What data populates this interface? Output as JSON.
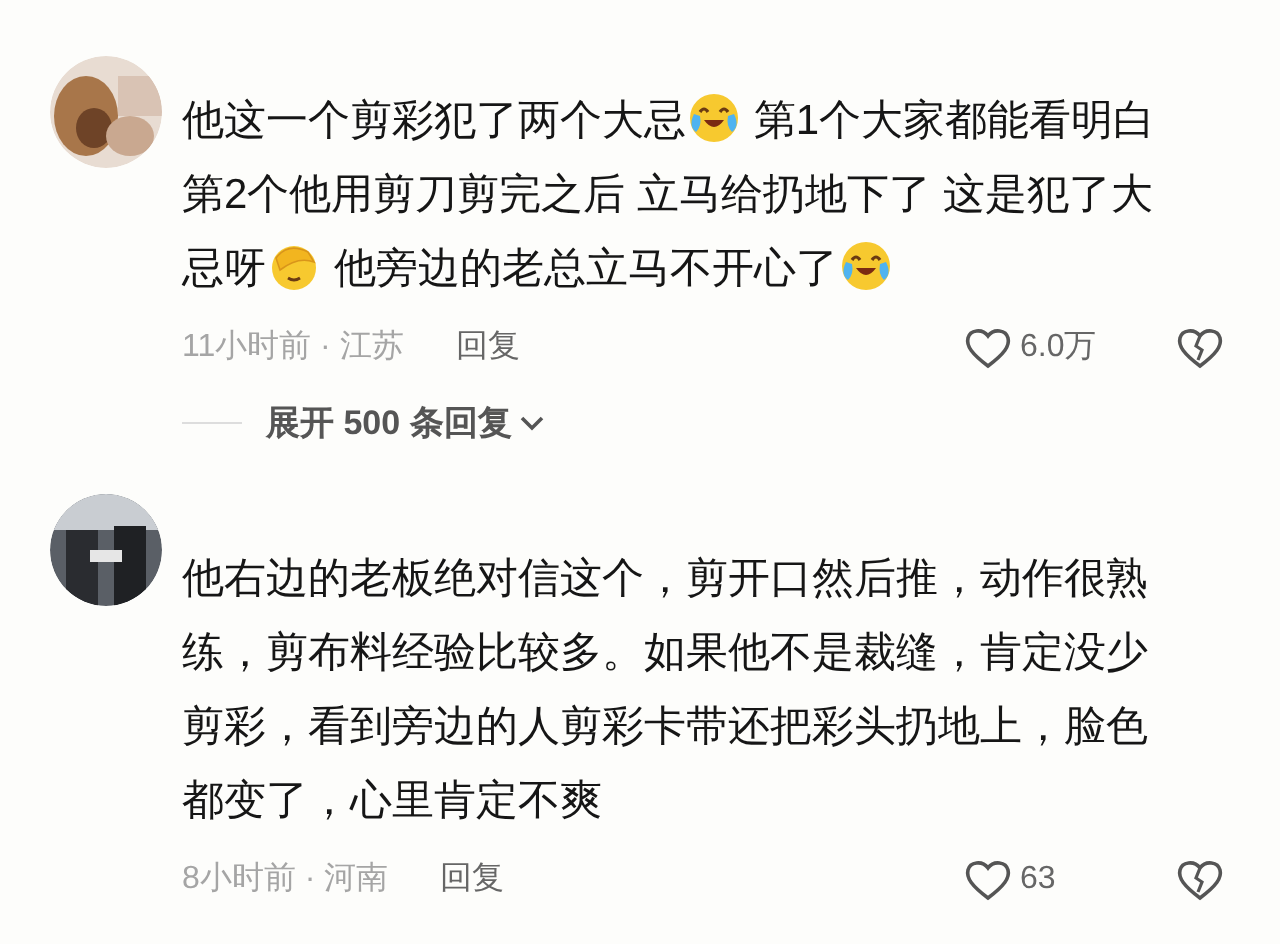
{
  "comments": [
    {
      "lines": [
        [
          {
            "kind": "text",
            "text": "他这一个剪彩犯了两个大忌"
          },
          {
            "kind": "laugh-cry"
          },
          {
            "kind": "text",
            "text": " 第1个大家都能看明白"
          }
        ],
        [
          {
            "kind": "text",
            "text": "第2个他用剪刀剪完之后 立马给扔地下了 这是犯了大"
          }
        ],
        [
          {
            "kind": "text",
            "text": "忌呀"
          },
          {
            "kind": "facepalm"
          },
          {
            "kind": "text",
            "text": " 他旁边的老总立马不开心了"
          },
          {
            "kind": "laugh-cry"
          }
        ]
      ],
      "time": "11小时前 · 江苏",
      "reply": "回复",
      "likes": "6.0万",
      "expand": "展开 500 条回复"
    },
    {
      "lines": [
        [
          {
            "kind": "text",
            "text": "他右边的老板绝对信这个，剪开口然后推，动作很熟"
          }
        ],
        [
          {
            "kind": "text",
            "text": "练，剪布料经验比较多。如果他不是裁缝，肯定没少"
          }
        ],
        [
          {
            "kind": "text",
            "text": "剪彩，看到旁边的人剪彩卡带还把彩头扔地上，脸色"
          }
        ],
        [
          {
            "kind": "text",
            "text": "都变了，心里肯定不爽"
          }
        ]
      ],
      "time": "8小时前 · 河南",
      "reply": "回复",
      "likes": "63"
    }
  ]
}
